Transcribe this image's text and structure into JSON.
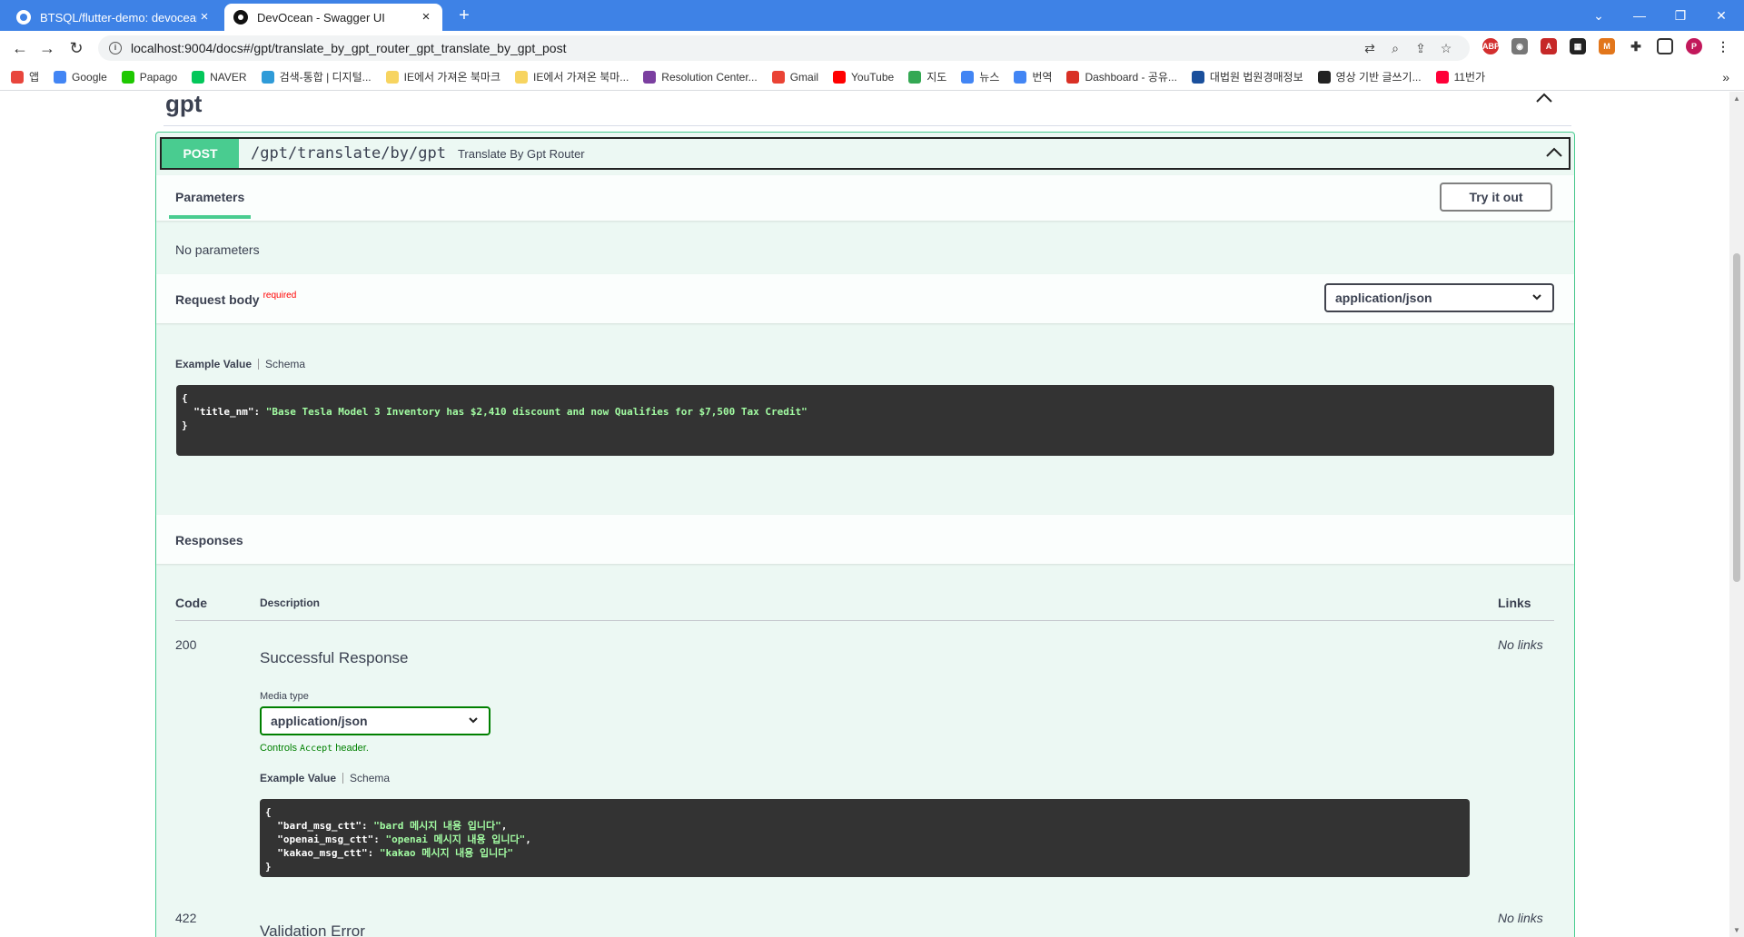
{
  "browser": {
    "tabs": [
      {
        "title": "BTSQL/flutter-demo: devocean | ",
        "active": false
      },
      {
        "title": "DevOcean - Swagger UI",
        "active": true
      }
    ],
    "url": "localhost:9004/docs#/gpt/translate_by_gpt_router_gpt_translate_by_gpt_post",
    "bookmarks": [
      {
        "label": "앱",
        "color": "#e8453c"
      },
      {
        "label": "Google",
        "color": "#4285f4"
      },
      {
        "label": "Papago",
        "color": "#1ec800"
      },
      {
        "label": "NAVER",
        "color": "#03c75a"
      },
      {
        "label": "검색-통합 | 디지털...",
        "color": "#2f9bd8"
      },
      {
        "label": "IE에서 가져온 북마크",
        "color": "#f7d460"
      },
      {
        "label": "IE에서 가져온 북마...",
        "color": "#f7d460"
      },
      {
        "label": "Resolution Center...",
        "color": "#7b3fa0"
      },
      {
        "label": "Gmail",
        "color": "#ea4335"
      },
      {
        "label": "YouTube",
        "color": "#ff0000"
      },
      {
        "label": "지도",
        "color": "#34a853"
      },
      {
        "label": "뉴스",
        "color": "#4285f4"
      },
      {
        "label": "번역",
        "color": "#4285f4"
      },
      {
        "label": "Dashboard - 공유...",
        "color": "#d93025"
      },
      {
        "label": "대법원 법원경매정보",
        "color": "#1a4f9c"
      },
      {
        "label": "영상 기반 글쓰기...",
        "color": "#222222"
      },
      {
        "label": "11번가",
        "color": "#ff0038"
      }
    ]
  },
  "swagger": {
    "tag": "gpt",
    "operation": {
      "method": "POST",
      "path": "/gpt/translate/by/gpt",
      "summary": "Translate By Gpt Router"
    },
    "parameters": {
      "tab_label": "Parameters",
      "try_label": "Try it out",
      "none_text": "No parameters"
    },
    "request_body": {
      "title": "Request body",
      "required_label": "required",
      "content_type": "application/json",
      "example_tab": "Example Value",
      "schema_tab": "Schema",
      "example": {
        "key": "\"title_nm\"",
        "value": "\"Base Tesla Model 3 Inventory has $2,410 discount and now Qualifies for $7,500 Tax Credit\""
      }
    },
    "responses": {
      "title": "Responses",
      "col_code": "Code",
      "col_description": "Description",
      "col_links": "Links",
      "items": [
        {
          "code": "200",
          "description": "Successful Response",
          "links": "No links",
          "media_type_label": "Media type",
          "media_type": "application/json",
          "controls_prefix": "Controls ",
          "controls_code": "Accept",
          "controls_suffix": " header.",
          "example_tab": "Example Value",
          "schema_tab": "Schema",
          "example": [
            {
              "key": "\"bard_msg_ctt\"",
              "value": "\"bard 메시지 내용 입니다\""
            },
            {
              "key": "\"openai_msg_ctt\"",
              "value": "\"openai 메시지 내용 입니다\""
            },
            {
              "key": "\"kakao_msg_ctt\"",
              "value": "\"kakao 메시지 내용 입니다\""
            }
          ]
        },
        {
          "code": "422",
          "description": "Validation Error",
          "links": "No links"
        }
      ]
    }
  },
  "colors": {
    "post": "#49cc90",
    "post_bg": "#ecf8f3",
    "chrome_blue": "#3e82e6"
  }
}
